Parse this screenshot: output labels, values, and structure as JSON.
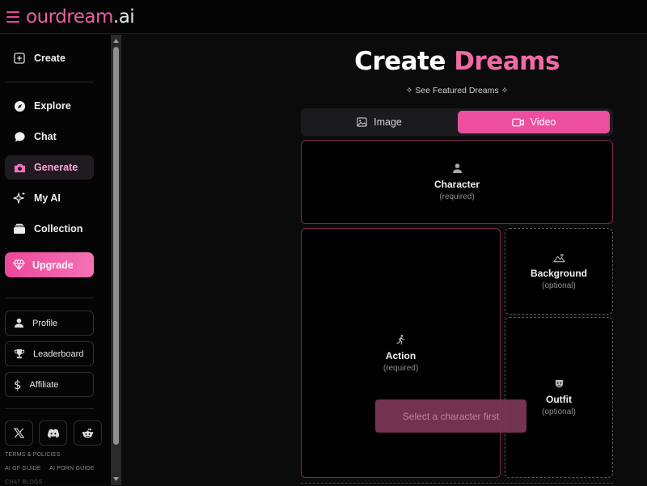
{
  "header": {
    "logo_brand": "ourdream",
    "logo_tld": ".ai"
  },
  "sidebar": {
    "create": "Create",
    "nav": [
      {
        "label": "Explore",
        "icon": "compass-icon"
      },
      {
        "label": "Chat",
        "icon": "chat-bubble-icon"
      },
      {
        "label": "Generate",
        "icon": "camera-icon",
        "active": true
      },
      {
        "label": "My AI",
        "icon": "sparkles-icon"
      },
      {
        "label": "Collection",
        "icon": "stack-icon"
      }
    ],
    "upgrade": "Upgrade",
    "secondary": [
      {
        "label": "Profile",
        "icon": "user-icon"
      },
      {
        "label": "Leaderboard",
        "icon": "trophy-icon"
      },
      {
        "label": "Affiliate",
        "icon": "dollar-icon"
      }
    ],
    "social": [
      "x-icon",
      "discord-icon",
      "reddit-icon"
    ],
    "footer": {
      "terms": "TERMS & POLICIES",
      "link1": "AI GF GUIDE",
      "link2": "AI PORN GUIDE",
      "link3": "CHAT BLOGS"
    }
  },
  "main": {
    "title_plain": "Create",
    "title_accent": "Dreams",
    "featured": "See Featured Dreams",
    "tabs": {
      "image": "Image",
      "video": "Video",
      "selected": "Video"
    },
    "cards": {
      "character": {
        "name": "Character",
        "req": "(required)"
      },
      "action": {
        "name": "Action",
        "req": "(required)"
      },
      "background": {
        "name": "Background",
        "req": "(optional)"
      },
      "outfit": {
        "name": "Outfit",
        "req": "(optional)"
      }
    },
    "select_button": "Select a character first"
  },
  "colors": {
    "accent": "#ec4fa0",
    "background": "#0b0b0c",
    "sidebar": "#050505"
  }
}
